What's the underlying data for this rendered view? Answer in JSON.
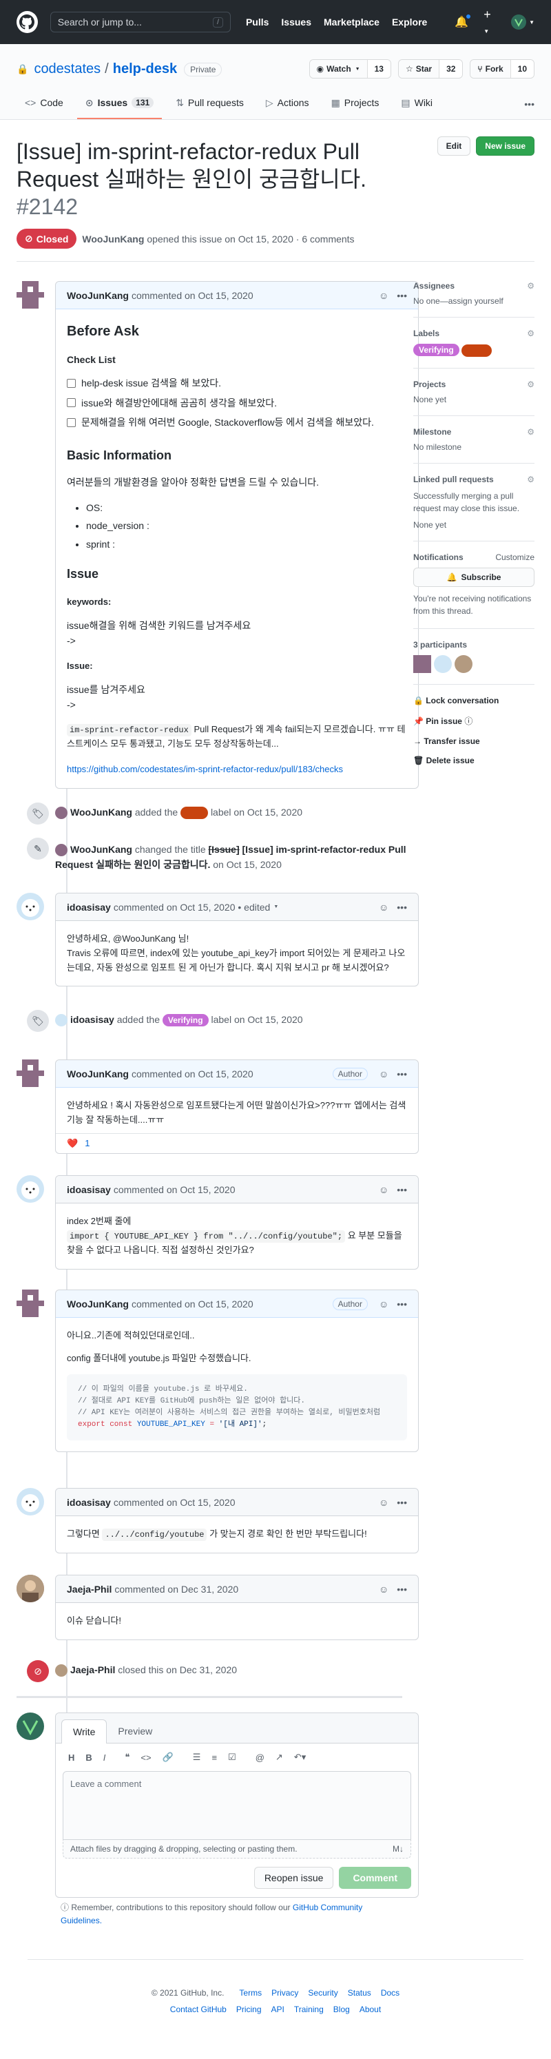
{
  "header": {
    "search_placeholder": "Search or jump to...",
    "slash_hint": "/",
    "nav": [
      "Pulls",
      "Issues",
      "Marketplace",
      "Explore"
    ],
    "plus": "+"
  },
  "repo": {
    "owner": "codestates",
    "sep": "/",
    "name": "help-desk",
    "visibility": "Private",
    "watch_label": "Watch",
    "watch_count": "13",
    "star_label": "Star",
    "star_count": "32",
    "fork_label": "Fork",
    "fork_count": "10",
    "tabs": [
      {
        "label": "Code",
        "icon": "<>"
      },
      {
        "label": "Issues",
        "count": "131",
        "icon": "⊙"
      },
      {
        "label": "Pull requests",
        "icon": "⇅"
      },
      {
        "label": "Actions",
        "icon": "▷"
      },
      {
        "label": "Projects",
        "icon": "▦"
      },
      {
        "label": "Wiki",
        "icon": "▤"
      }
    ]
  },
  "issue": {
    "title": "[Issue] im-sprint-refactor-redux Pull Request 실패하는 원인이 궁금합니다.",
    "number": "#2142",
    "state": "Closed",
    "author": "WooJunKang",
    "meta": "opened this issue on Oct 15, 2020 · 6 comments",
    "edit_label": "Edit",
    "new_issue_label": "New issue"
  },
  "comments": {
    "c1": {
      "author": "WooJunKang",
      "meta": "commented on Oct 15, 2020",
      "h_before_ask": "Before Ask",
      "h_checklist": "Check List",
      "checklist": [
        "help-desk issue 검색을 해 보았다.",
        "issue와 해결방안에대해 곰곰히 생각을 해보았다.",
        "문제해결을 위해 여러번 Google, Stackoverflow등 에서 검색을 해보았다."
      ],
      "h_basic": "Basic Information",
      "basic_intro": "여러분들의 개발환경을 알아야 정확한 답변을 드릴 수 있습니다.",
      "basic_items": [
        "OS:",
        "node_version :",
        "sprint :"
      ],
      "h_issue": "Issue",
      "keywords_label": "keywords:",
      "keywords_text": "issue해결을 위해 검색한 키워드를 남겨주세요",
      "arrow1": "->",
      "issue_label": "Issue:",
      "issue_text": "issue를 남겨주세요",
      "arrow2": "->",
      "code_inline": "im-sprint-refactor-redux",
      "body_line1": " Pull Request가 왜 계속 fail되는지 모르겠습니다. ㅠㅠ 테스트케이스 모두 통과됐고, 기능도 모두 정상작동하는데...",
      "link": "https://github.com/codestates/im-sprint-refactor-redux/pull/183/checks"
    },
    "c2": {
      "author": "idoasisay",
      "meta": "commented on Oct 15, 2020 • edited",
      "line1": "안녕하세요, @WooJunKang 님!",
      "line2": "Travis 오류에 따르면, index에 있는 youtube_api_key가 import 되어있는 게 문제라고 나오는데요, 자동 완성으로 임포트 된 게 아닌가 합니다. 혹시 지워 보시고 pr 해 보시겠어요?"
    },
    "c3": {
      "author": "WooJunKang",
      "meta": "commented on Oct 15, 2020",
      "badge": "Author",
      "line1": "안녕하세요 ! 혹시 자동완성으로 임포트됐다는게 어떤 말씀이신가요>???ㅠㅠ 엡에서는 검색기능 잘 작동하는데....ㅠㅠ",
      "reaction": "❤️",
      "reaction_count": "1"
    },
    "c4": {
      "author": "idoasisay",
      "meta": "commented on Oct 15, 2020",
      "line1": "index 2번째 줄에",
      "code": "import { YOUTUBE_API_KEY } from \"../../config/youtube\";",
      "line2": " 요 부분 모듈을 찾을 수 없다고 나옵니다. 직접 설정하신 것인가요?"
    },
    "c5": {
      "author": "WooJunKang",
      "meta": "commented on Oct 15, 2020",
      "badge": "Author",
      "line1": "아니요..기존에 적혀있던대로인데..",
      "line2": "config 폴더내에 youtube.js 파일만 수정했습니다.",
      "code1": "// 이 파일의 이름을 youtube.js 로 바꾸세요.",
      "code2": "// 절대로 API KEY를 GitHub에 push하는 일은 없어야 합니다.",
      "code3": "// API KEY는 여러분이 사용하는 서비스의 접근 권한을 부여하는 열쇠로, 비밀번호처럼",
      "code4_kw": "export const",
      "code4_var": " YOUTUBE_API_KEY ",
      "code4_eq": "= ",
      "code4_str": "'[내 API]'",
      "code4_end": ";"
    },
    "c6": {
      "author": "idoasisay",
      "meta": "commented on Oct 15, 2020",
      "pre": "그렇다면 ",
      "code": "../../config/youtube",
      "post": " 가 맞는지 경로 확인 한 번만 부탁드립니다!"
    },
    "c7": {
      "author": "Jaeja-Phil",
      "meta": "commented on Dec 31, 2020",
      "line1": "이슈 닫습니다!"
    }
  },
  "events": {
    "e1": {
      "actor": "WooJunKang",
      "text1": "added the",
      "label": "",
      "text2": "label on Oct 15, 2020"
    },
    "e2": {
      "actor": "WooJunKang",
      "text1": "changed the title",
      "old": "[Issue]",
      "new": "[Issue] im-sprint-refactor-redux Pull Request 실패하는 원인이 궁금합니다.",
      "text2": "on Oct 15, 2020"
    },
    "e3": {
      "actor": "idoasisay",
      "text1": "added the",
      "label": "Verifying",
      "text2": "label on Oct 15, 2020"
    },
    "e4": {
      "actor": "Jaeja-Phil",
      "text1": "closed this on Dec 31, 2020"
    }
  },
  "sidebar": {
    "assignees_h": "Assignees",
    "assignees_v": "No one—assign yourself",
    "labels_h": "Labels",
    "label1": "Verifying",
    "label2": "",
    "projects_h": "Projects",
    "projects_v": "None yet",
    "milestone_h": "Milestone",
    "milestone_v": "No milestone",
    "linked_h": "Linked pull requests",
    "linked_desc": "Successfully merging a pull request may close this issue.",
    "linked_v": "None yet",
    "notif_h": "Notifications",
    "customize": "Customize",
    "subscribe": "Subscribe",
    "notif_desc": "You're not receiving notifications from this thread.",
    "participants": "3 participants",
    "lock": "Lock conversation",
    "pin": "Pin issue",
    "transfer": "Transfer issue",
    "delete": "Delete issue"
  },
  "composer": {
    "tab_write": "Write",
    "tab_preview": "Preview",
    "placeholder": "Leave a comment",
    "attach": "Attach files by dragging & dropping, selecting or pasting them.",
    "reopen": "Reopen issue",
    "submit": "Comment",
    "remember": "Remember, contributions to this repository should follow our",
    "guidelines": "GitHub Community Guidelines."
  },
  "footer": {
    "copyright": "© 2021 GitHub, Inc.",
    "row1": [
      "Terms",
      "Privacy",
      "Security",
      "Status",
      "Docs"
    ],
    "row2": [
      "Contact GitHub",
      "Pricing",
      "API",
      "Training",
      "Blog",
      "About"
    ]
  },
  "colors": {
    "accent": "#0366d6",
    "closed": "#d73a49",
    "green": "#2ea44f",
    "verifying": "#c56bd6",
    "label_red": "#c8430f"
  }
}
